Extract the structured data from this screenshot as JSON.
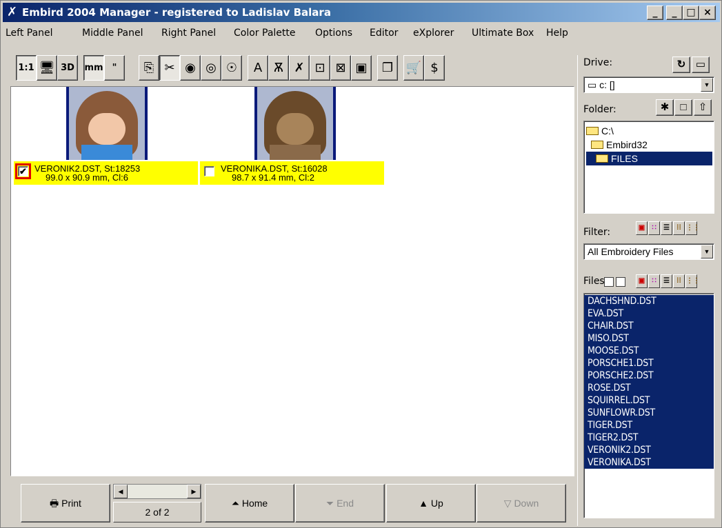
{
  "window": {
    "title": "Embird 2004 Manager - registered to Ladislav Balara",
    "app_icon": "embird-needle-icon",
    "controls": [
      "_",
      "_",
      "□",
      "×"
    ]
  },
  "menu": [
    "Left Panel",
    "Middle Panel",
    "Right Panel",
    "Color Palette",
    "Options",
    "Editor",
    "eXplorer",
    "Ultimate Box",
    "Help"
  ],
  "toolbar": {
    "actual_size": "1:1",
    "three_d": "3D",
    "metric": "mm",
    "imperial": "\"",
    "text": "A"
  },
  "designs": [
    {
      "name_line": "VERONIK2.DST, St:18253",
      "size_line": "99.0 x 90.9 mm, Cl:6",
      "checked": "✔",
      "colors": "full"
    },
    {
      "name_line": "VERONIKA.DST, St:16028",
      "size_line": "98.7 x 91.4 mm, Cl:2",
      "checked": "",
      "colors": "brown"
    }
  ],
  "bottom": {
    "print": "Print",
    "home": "Home",
    "end": "End",
    "up": "Up",
    "down": "Down",
    "page": "2 of 2"
  },
  "right_panel": {
    "drive_label": "Drive:",
    "drive_value": "c: []",
    "folder_label": "Folder:",
    "folders": [
      "C:\\",
      "Embird32",
      "FILES"
    ],
    "filter_label": "Filter:",
    "filter_value": "All Embroidery Files",
    "files_label": "Files",
    "files": [
      "DACHSHND.DST",
      "EVA.DST",
      "CHAIR.DST",
      "MISO.DST",
      "MOOSE.DST",
      "PORSCHE1.DST",
      "PORSCHE2.DST",
      "ROSE.DST",
      "SQUIRREL.DST",
      "SUNFLOWR.DST",
      "TIGER.DST",
      "TIGER2.DST",
      "VERONIK2.DST",
      "VERONIKA.DST"
    ]
  },
  "colors": {
    "selection": "#0a246a",
    "caption_bg": "#ffff00",
    "focus_outline": "#e00000"
  }
}
